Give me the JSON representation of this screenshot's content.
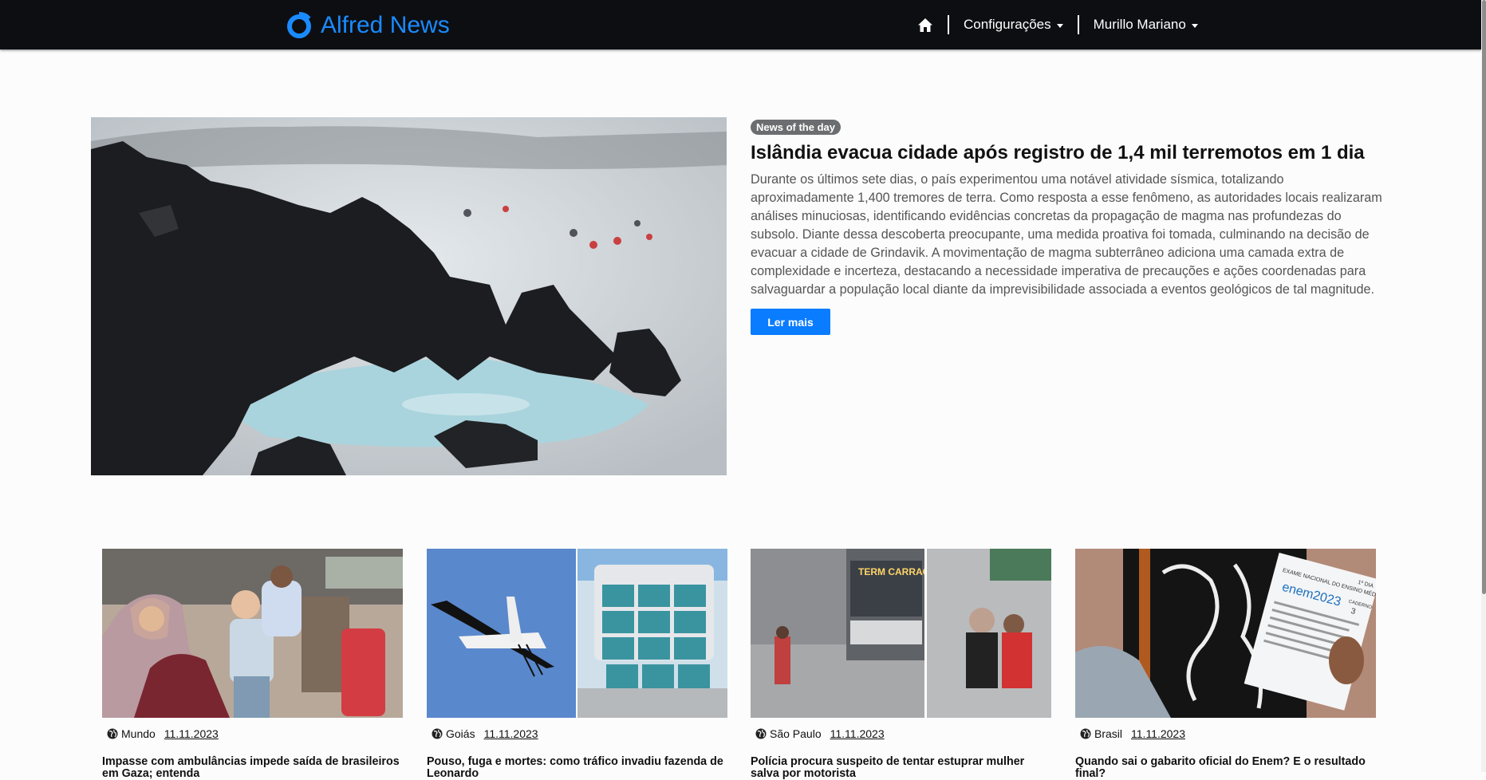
{
  "brand": {
    "name": "Alfred News",
    "logo_icon": "ring-logo-icon",
    "color": "#1a8bff"
  },
  "nav": {
    "home_icon": "home-icon",
    "settings_label": "Configurações",
    "user_label": "Murillo Mariano"
  },
  "hero": {
    "badge": "News of the day",
    "title": "Islândia evacua cidade após registro de 1,4 mil terremotos em 1 dia",
    "body": "Durante os últimos sete dias, o país experimentou uma notável atividade sísmica, totalizando aproximadamente 1,400 tremores de terra. Como resposta a esse fenômeno, as autoridades locais realizaram análises minuciosas, identificando evidências concretas da propagação de magma nas profundezas do subsolo. Diante dessa descoberta preocupante, uma medida proativa foi tomada, culminando na decisão de evacuar a cidade de Grindavik. A movimentação de magma subterrâneo adiciona uma camada extra de complexidade e incerteza, destacando a necessidade imperativa de precauções e ações coordenadas para salvaguardar a população local diante da imprevisibilidade associada a eventos geológicos de tal magnitude.",
    "button_label": "Ler mais",
    "accent": "#0a7cff"
  },
  "cards": [
    {
      "category": "Mundo",
      "date": "11.11.2023",
      "title": "Impasse com ambulâncias impede saída de brasileiros em Gaza; entenda"
    },
    {
      "category": "Goiás",
      "date": "11.11.2023",
      "title": "Pouso, fuga e mortes: como tráfico invadiu fazenda de Leonardo"
    },
    {
      "category": "São Paulo",
      "date": "11.11.2023",
      "title": "Polícia procura suspeito de tentar estuprar mulher salva por motorista"
    },
    {
      "category": "Brasil",
      "date": "11.11.2023",
      "title": "Quando sai o gabarito oficial do Enem? E o resultado final?"
    }
  ],
  "card_images": {
    "card1": "Photo of a woman in a hijab holding a toddler",
    "card2_sign_1": "TERM CARRAO",
    "card4_sheet_1": "EXAME NACIONAL DO ENSINO MÉDIO",
    "card4_sheet_2": "enem2023",
    "card4_sheet_3": "1º DIA",
    "card4_sheet_4": "CADERNO",
    "card4_sheet_5": "3"
  }
}
